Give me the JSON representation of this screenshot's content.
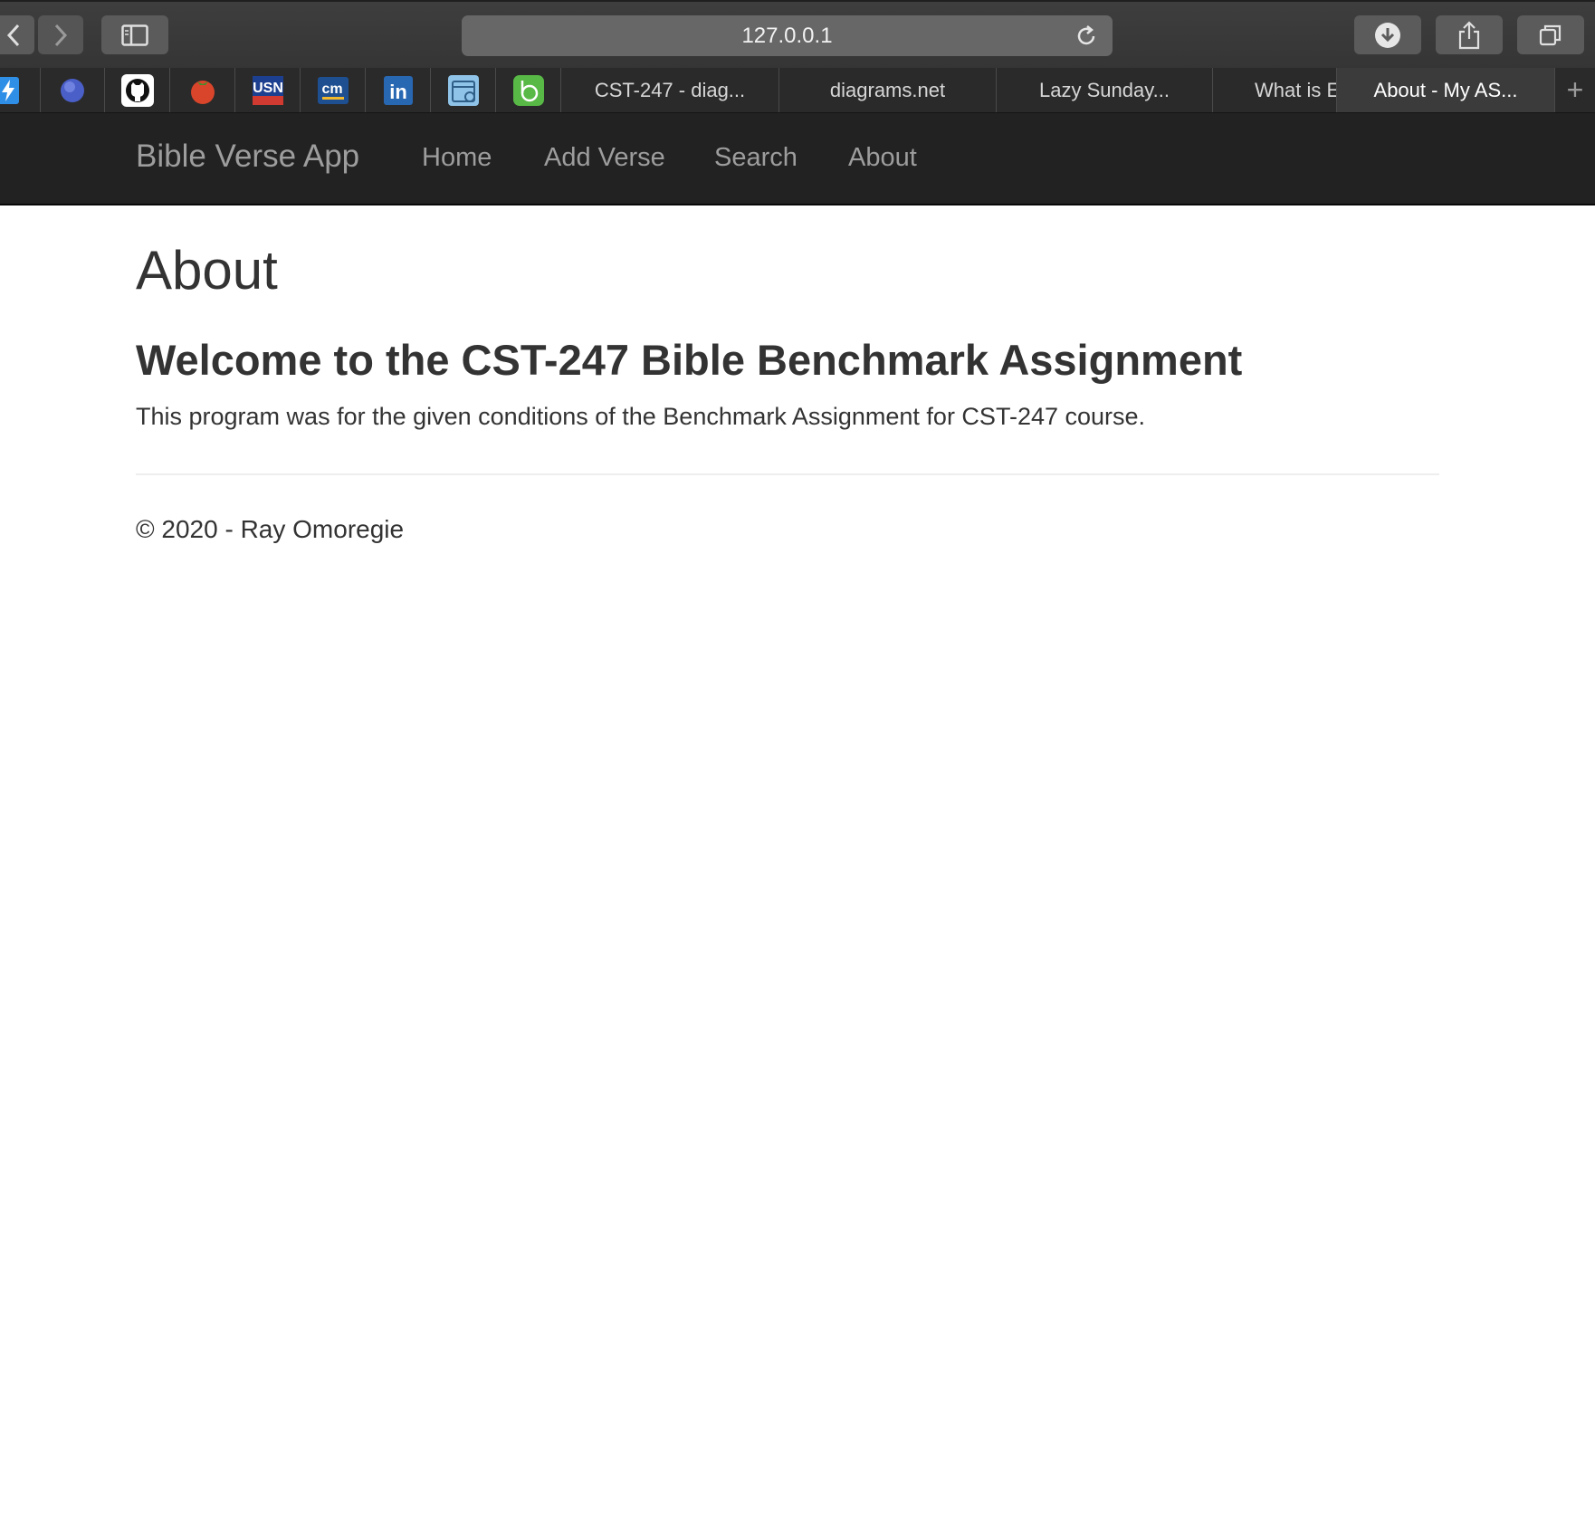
{
  "browser": {
    "address": "127.0.0.1",
    "favorites": [
      {
        "icon": "bolt-icon",
        "color": "#2f8ee6"
      },
      {
        "icon": "blue-circle-icon",
        "color": "#4a5fc8"
      },
      {
        "icon": "github-icon",
        "color": "#ffffff"
      },
      {
        "icon": "tomato-icon",
        "color": "#d9452b"
      },
      {
        "icon": "usn-icon",
        "label": "USN",
        "color": "#d03a30"
      },
      {
        "icon": "cm-icon",
        "label": "cm",
        "color": "#1d4f91"
      },
      {
        "icon": "linkedin-icon",
        "label": "in",
        "color": "#2867b2"
      },
      {
        "icon": "calendar-icon",
        "color": "#5ba2d6"
      },
      {
        "icon": "green-app-icon",
        "color": "#58b947"
      }
    ],
    "tabs": [
      {
        "label": "CST-247 - diag..."
      },
      {
        "label": "diagrams.net"
      },
      {
        "label": "Lazy Sunday..."
      },
      {
        "label": "What is E"
      },
      {
        "label": "About - My AS...",
        "active": true
      }
    ],
    "new_tab_label": "+"
  },
  "navbar": {
    "brand": "Bible Verse App",
    "links": [
      {
        "label": "Home"
      },
      {
        "label": "Add Verse"
      },
      {
        "label": "Search"
      },
      {
        "label": "About"
      }
    ]
  },
  "content": {
    "page_title": "About",
    "subtitle": "Welcome to the CST-247 Bible Benchmark Assignment",
    "description": "This program was for the given conditions of the Benchmark Assignment for CST-247 course.",
    "footer": "© 2020 - Ray Omoregie"
  }
}
